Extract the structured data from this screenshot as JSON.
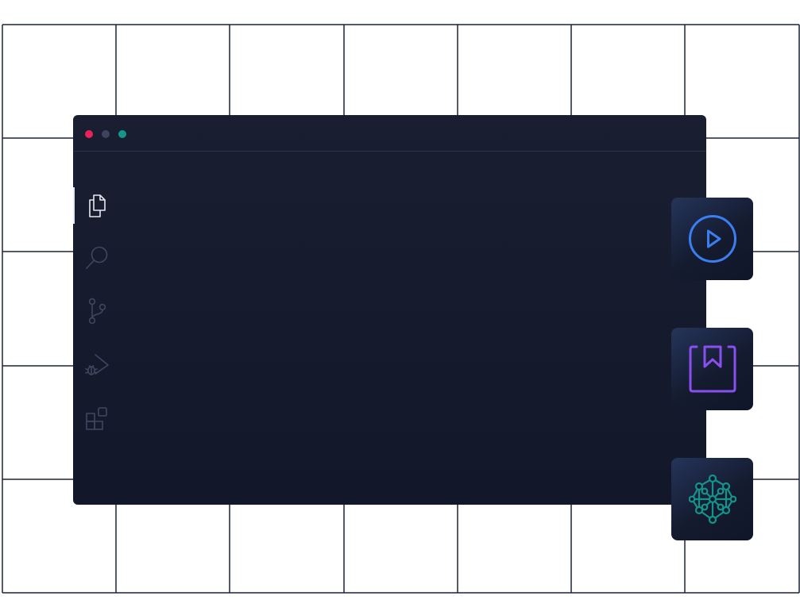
{
  "window": {
    "traffic_lights": [
      {
        "name": "close",
        "color": "#e6245a"
      },
      {
        "name": "minimize",
        "color": "#3d455e"
      },
      {
        "name": "maximize",
        "color": "#14968a"
      }
    ]
  },
  "activity_bar": {
    "items": [
      {
        "name": "explorer",
        "icon": "files-icon",
        "active": true,
        "color": "#e5e8ef"
      },
      {
        "name": "search",
        "icon": "search-icon",
        "active": false,
        "color": "#3f4760"
      },
      {
        "name": "source-control",
        "icon": "git-branch-icon",
        "active": false,
        "color": "#3f4760"
      },
      {
        "name": "run-and-debug",
        "icon": "run-debug-icon",
        "active": false,
        "color": "#3f4760"
      },
      {
        "name": "extensions",
        "icon": "extensions-icon",
        "active": false,
        "color": "#3f4760"
      }
    ]
  },
  "tiles": [
    {
      "name": "run",
      "icon": "play-circle-icon",
      "color": "#3b7ef2"
    },
    {
      "name": "bookmarks",
      "icon": "bookmark-icon",
      "color": "#8a4ff0"
    },
    {
      "name": "network",
      "icon": "network-graph-icon",
      "color": "#13948a"
    }
  ],
  "colors": {
    "grid_line": "#1d2437",
    "window_bg": "#161c2d",
    "titlebar_border": "#2b3347"
  }
}
